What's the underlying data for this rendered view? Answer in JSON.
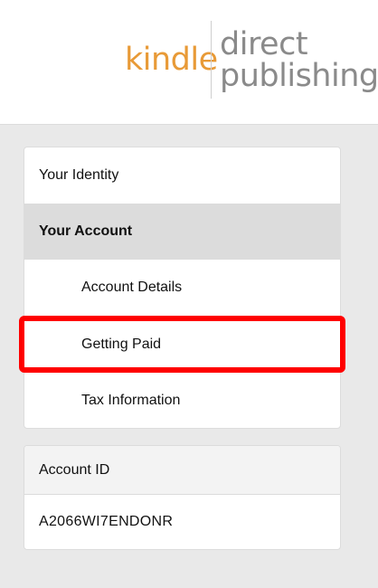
{
  "header": {
    "logo": {
      "kindle": "kindle",
      "direct": "direct",
      "publishing": "publishing"
    }
  },
  "menu": {
    "items": [
      {
        "label": "Your Identity"
      },
      {
        "label": "Your Account"
      },
      {
        "label": "Account Details"
      },
      {
        "label": "Getting Paid"
      },
      {
        "label": "Tax Information"
      }
    ],
    "active_index": 1,
    "highlighted_index": 3
  },
  "account": {
    "header_label": "Account ID",
    "id_value": "A2066WI7ENDONR"
  },
  "colors": {
    "kindle_orange": "#e89a37",
    "logo_gray": "#8a8a8a",
    "highlight_red": "#ff0000",
    "active_bg": "#dcdcdc",
    "page_bg": "#e9e9e9"
  }
}
